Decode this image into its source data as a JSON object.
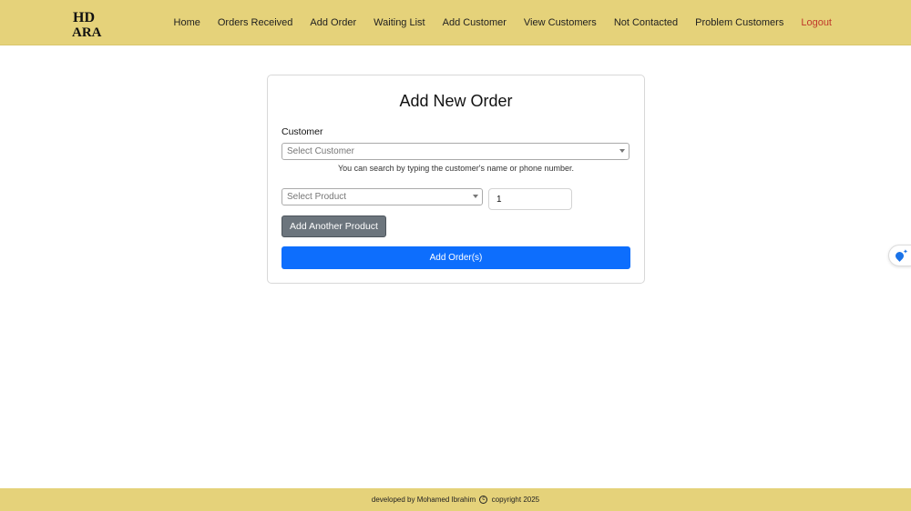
{
  "brand": {
    "logo_text_top": "HD",
    "logo_text_bottom": "ARA"
  },
  "nav": {
    "items": [
      {
        "label": "Home"
      },
      {
        "label": "Orders Received"
      },
      {
        "label": "Add Order"
      },
      {
        "label": "Waiting List"
      },
      {
        "label": "Add Customer"
      },
      {
        "label": "View Customers"
      },
      {
        "label": "Not Contacted"
      },
      {
        "label": "Problem Customers"
      }
    ],
    "logout_label": "Logout"
  },
  "form": {
    "title": "Add New Order",
    "customer_label": "Customer",
    "customer_placeholder": "Select Customer",
    "customer_help": "You can search by typing the customer's name or phone number.",
    "product_placeholder": "Select Product",
    "quantity_value": "1",
    "add_product_label": "Add Another Product",
    "submit_label": "Add Order(s)"
  },
  "footer": {
    "text_before": "developed by Mohamed Ibrahim",
    "copyright_symbol": "c",
    "text_after": "copyright 2025"
  },
  "colors": {
    "navbar": "#e5d27a",
    "primary": "#0d6efd",
    "secondary": "#6c757d",
    "logout": "#c0392b"
  },
  "icons": {
    "side_widget": "assistant-drop-icon"
  }
}
